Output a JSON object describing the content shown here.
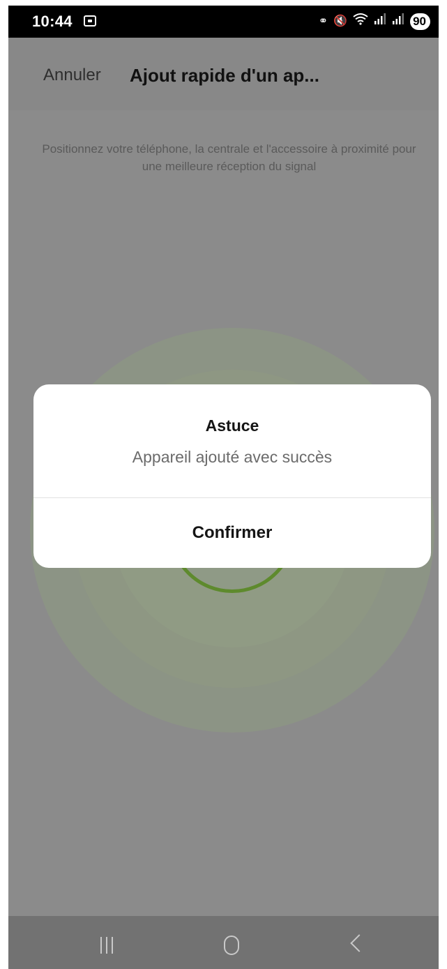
{
  "status_bar": {
    "time": "10:44",
    "battery": "90",
    "icons": [
      "screenshot-icon",
      "vpn-key-icon",
      "mute-icon",
      "wifi-icon",
      "signal-icon",
      "signal-icon",
      "battery-icon"
    ]
  },
  "header": {
    "cancel_label": "Annuler",
    "title": "Ajout rapide d'un ap..."
  },
  "main": {
    "instructions": "Positionnez votre téléphone, la centrale et l'accessoire à proximité pour une meilleure réception du signal"
  },
  "dialog": {
    "title": "Astuce",
    "message": "Appareil ajouté avec succès",
    "confirm_label": "Confirmer"
  },
  "colors": {
    "overlay": "#8a8a8a",
    "accent_green": "#5e8a2d",
    "dialog_bg": "#ffffff"
  }
}
